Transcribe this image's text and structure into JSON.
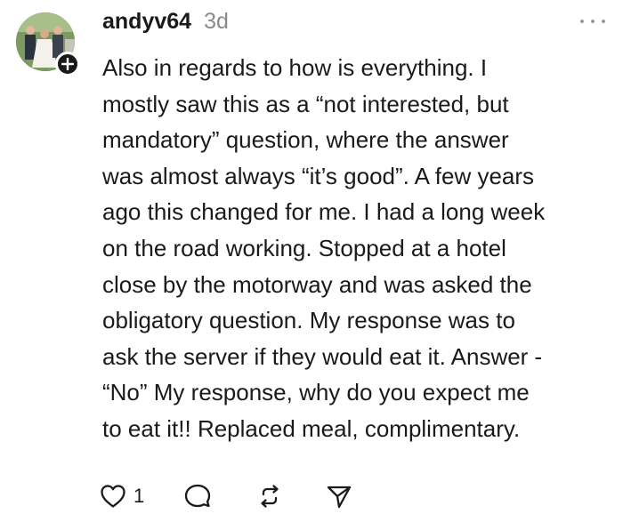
{
  "comment": {
    "author": "andyv64",
    "time_ago": "3d",
    "body": "Also in regards to how is everything. I\nmostly saw this as a “not interested, but\nmandatory” question, where the answer\nwas almost always “it’s good”. A few years\nago this changed for me. I had a long week\non the road working. Stopped at a hotel\nclose by the motorway and was asked the\nobligatory question. My response was to\nask the server if they would eat it. Answer -\n“No” My response, why do you expect me\nto eat it!! Replaced meal, complimentary.",
    "like_count": "1"
  },
  "icons": {
    "follow": "plus-icon",
    "more": "more-horizontal-icon",
    "like": "heart-icon",
    "reply": "comment-bubble-icon",
    "repost": "repost-icon",
    "share": "send-icon"
  },
  "colors": {
    "text": "#1a1a1a",
    "muted": "#8a8a8a",
    "background": "#ffffff"
  }
}
